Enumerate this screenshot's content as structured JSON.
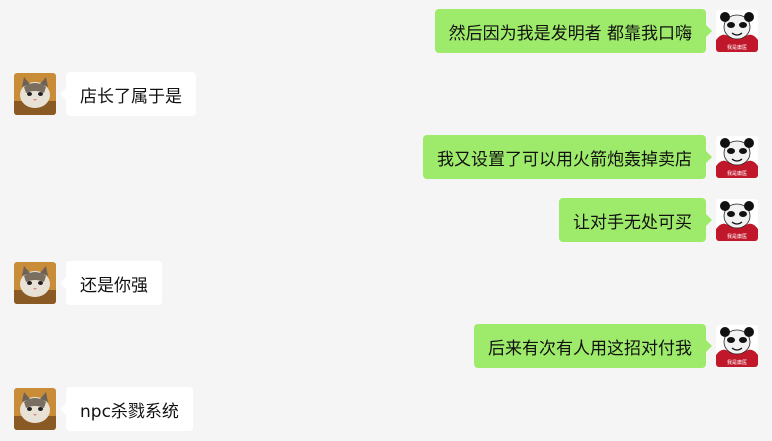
{
  "conversation": {
    "messages": [
      {
        "side": "out",
        "text": "然后因为我是发明者 都靠我口嗨",
        "avatar": "panda-meme-avatar",
        "avatar_caption": "我是庸医"
      },
      {
        "side": "in",
        "text": "店长了属于是",
        "avatar": "cat-avatar"
      },
      {
        "side": "out",
        "text": "我又设置了可以用火箭炮轰掉卖店",
        "avatar": "panda-meme-avatar",
        "avatar_caption": "我是庸医"
      },
      {
        "side": "out",
        "text": "让对手无处可买",
        "avatar": "panda-meme-avatar",
        "avatar_caption": "我是庸医"
      },
      {
        "side": "in",
        "text": "还是你强",
        "avatar": "cat-avatar"
      },
      {
        "side": "out",
        "text": "后来有次有人用这招对付我",
        "avatar": "panda-meme-avatar",
        "avatar_caption": "我是庸医"
      },
      {
        "side": "in",
        "text": "npc杀戮系统",
        "avatar": "cat-avatar"
      }
    ]
  },
  "colors": {
    "background": "#f5f5f5",
    "outgoing_bubble": "#9eea6a",
    "incoming_bubble": "#ffffff",
    "text": "#111111"
  }
}
